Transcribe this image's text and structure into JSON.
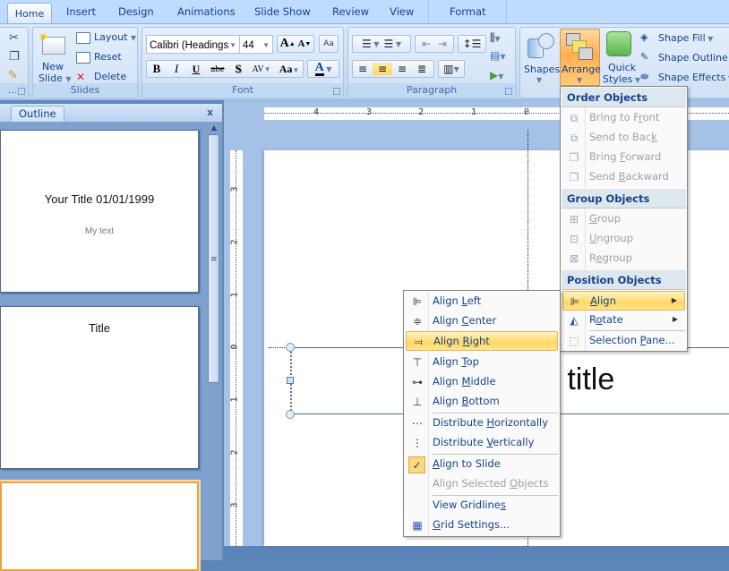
{
  "tabs": [
    {
      "label": "Home",
      "active": true
    },
    {
      "label": "Insert"
    },
    {
      "label": "Design"
    },
    {
      "label": "Animations"
    },
    {
      "label": "Slide Show"
    },
    {
      "label": "Review"
    },
    {
      "label": "View"
    },
    {
      "label": "Format"
    }
  ],
  "ribbon": {
    "clipboard": {
      "label": "..."
    },
    "slides": {
      "label": "Slides",
      "new_slide": "New",
      "new_slide2": "Slide",
      "layout": "Layout",
      "reset": "Reset",
      "delete": "Delete"
    },
    "font": {
      "label": "Font",
      "font_name": "Calibri (Headings",
      "font_size": "44",
      "bold": "B",
      "italic": "I",
      "underline": "U",
      "strike": "abe",
      "shadow": "S",
      "spacing": "AV",
      "case": "Aa",
      "color": "A",
      "grow": "A",
      "shrink": "A"
    },
    "paragraph": {
      "label": "Paragraph"
    },
    "drawing": {
      "shapes": "Shapes",
      "arrange": "Arrange",
      "quick": "Quick",
      "styles": "Styles",
      "shape_fill": "Shape Fill",
      "shape_outline": "Shape Outline",
      "shape_effects": "Shape Effects"
    }
  },
  "pane": {
    "outline_tab": "Outline",
    "close": "x"
  },
  "thumbnails": [
    {
      "title": "Your Title 01/01/1999",
      "subtitle": "My text"
    },
    {
      "title": "Title",
      "subtitle": ""
    },
    {
      "title": "",
      "subtitle": "",
      "selected": true
    }
  ],
  "ruler": {
    "h_labels": [
      "4",
      "3",
      "2",
      "1",
      "0"
    ],
    "v_labels": [
      "3",
      "2",
      "1",
      "0",
      "1",
      "2",
      "3"
    ]
  },
  "slide": {
    "title_visible": "d title"
  },
  "arrange_menu": {
    "sections": [
      {
        "header": "Order Objects",
        "items": [
          {
            "label": "Bring to Front",
            "mn": "r",
            "pre": "Bring to F",
            "post": "ont",
            "disabled": true,
            "icon": "bring-to-front-icon"
          },
          {
            "label": "Send to Back",
            "pre": "Send to Bac",
            "mn": "k",
            "post": "",
            "disabled": true,
            "icon": "send-to-back-icon"
          },
          {
            "label": "Bring Forward",
            "pre": "Bring ",
            "mn": "F",
            "post": "orward",
            "disabled": true,
            "icon": "bring-forward-icon"
          },
          {
            "label": "Send Backward",
            "pre": "Send ",
            "mn": "B",
            "post": "ackward",
            "disabled": true,
            "icon": "send-backward-icon"
          }
        ]
      },
      {
        "header": "Group Objects",
        "items": [
          {
            "label": "Group",
            "pre": "",
            "mn": "G",
            "post": "roup",
            "disabled": true,
            "icon": "group-icon"
          },
          {
            "label": "Ungroup",
            "pre": "",
            "mn": "U",
            "post": "ngroup",
            "disabled": true,
            "icon": "ungroup-icon"
          },
          {
            "label": "Regroup",
            "pre": "R",
            "mn": "e",
            "post": "group",
            "disabled": true,
            "icon": "regroup-icon"
          }
        ]
      },
      {
        "header": "Position Objects",
        "items": [
          {
            "label": "Align",
            "pre": "",
            "mn": "A",
            "post": "lign",
            "submenu": true,
            "highlighted": true,
            "icon": "align-icon"
          },
          {
            "label": "Rotate",
            "pre": "R",
            "mn": "o",
            "post": "tate",
            "submenu": true,
            "icon": "rotate-icon"
          },
          {
            "label": "Selection Pane...",
            "pre": "Selection ",
            "mn": "P",
            "post": "ane...",
            "icon": "selection-pane-icon"
          }
        ]
      }
    ]
  },
  "align_menu": {
    "items": [
      {
        "label": "Align Left",
        "pre": "Align ",
        "mn": "L",
        "post": "eft",
        "icon": "align-left-icon"
      },
      {
        "label": "Align Center",
        "pre": "Align ",
        "mn": "C",
        "post": "enter",
        "icon": "align-center-icon"
      },
      {
        "label": "Align Right",
        "pre": "Align ",
        "mn": "R",
        "post": "ight",
        "highlighted": true,
        "icon": "align-right-icon"
      },
      {
        "label": "Align Top",
        "pre": "Align ",
        "mn": "T",
        "post": "op",
        "icon": "align-top-icon"
      },
      {
        "label": "Align Middle",
        "pre": "Align ",
        "mn": "M",
        "post": "iddle",
        "icon": "align-middle-icon"
      },
      {
        "label": "Align Bottom",
        "pre": "Align ",
        "mn": "B",
        "post": "ottom",
        "icon": "align-bottom-icon"
      },
      {
        "label": "Distribute Horizontally",
        "pre": "Distribute ",
        "mn": "H",
        "post": "orizontally",
        "icon": "distribute-horizontally-icon"
      },
      {
        "label": "Distribute Vertically",
        "pre": "Distribute ",
        "mn": "V",
        "post": "ertically",
        "icon": "distribute-vertically-icon"
      },
      {
        "label": "Align to Slide",
        "pre": "",
        "mn": "A",
        "post": "lign to Slide",
        "checked": true,
        "icon": "checkmark-icon"
      },
      {
        "label": "Align Selected Objects",
        "pre": "Align Selected ",
        "mn": "O",
        "post": "bjects",
        "disabled": true
      },
      {
        "label": "View Gridlines",
        "pre": "View Gridline",
        "mn": "s",
        "post": ""
      },
      {
        "label": "Grid Settings...",
        "pre": "",
        "mn": "G",
        "post": "rid Settings...",
        "icon": "grid-icon"
      }
    ]
  }
}
